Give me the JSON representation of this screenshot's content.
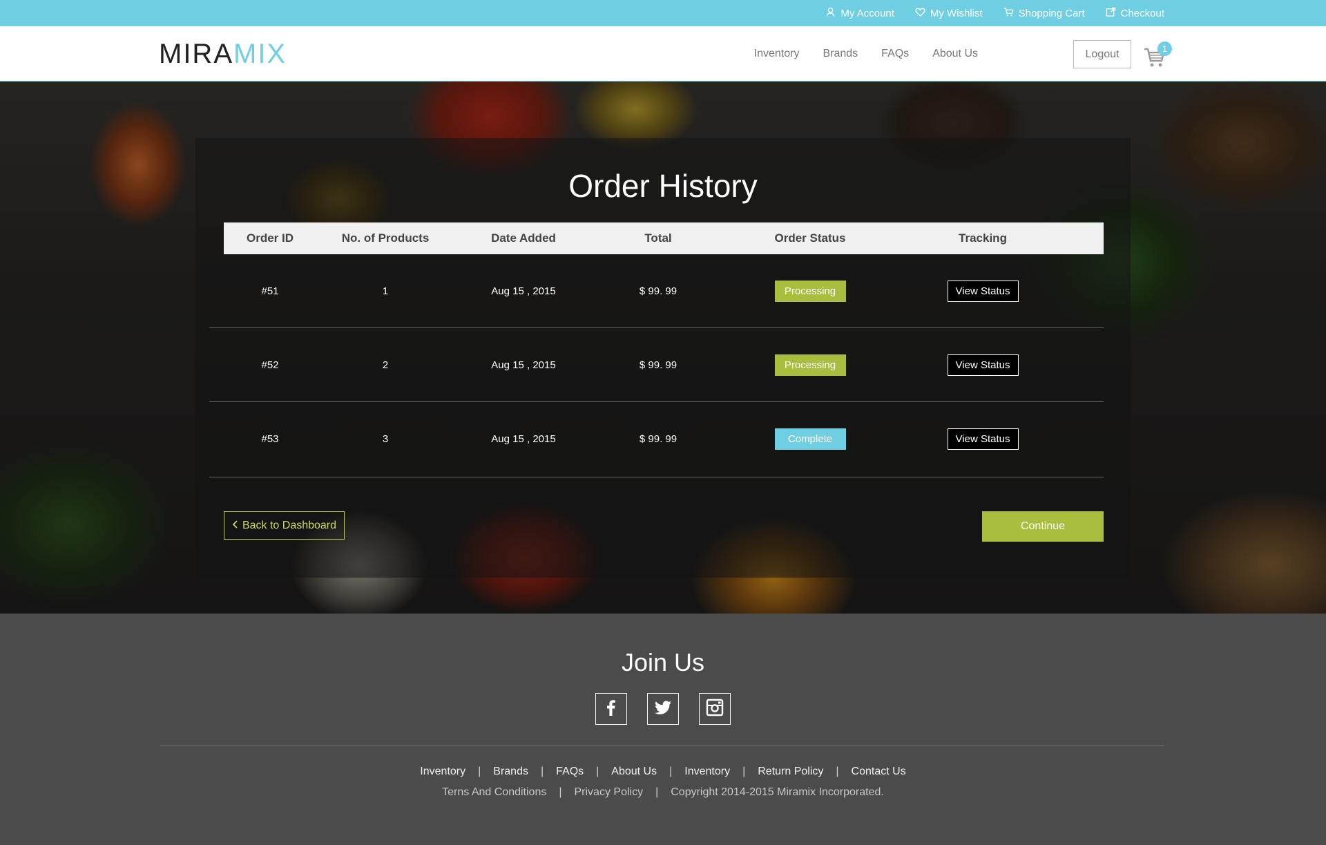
{
  "topbar": {
    "links": [
      {
        "label": "My Account",
        "icon": "user-icon"
      },
      {
        "label": "My Wishlist",
        "icon": "heart-icon"
      },
      {
        "label": "Shopping Cart",
        "icon": "cart-icon"
      },
      {
        "label": "Checkout",
        "icon": "checkout-icon"
      }
    ]
  },
  "header": {
    "logo_part1": "MIRA",
    "logo_part2": "MIX",
    "nav": [
      "Inventory",
      "Brands",
      "FAQs",
      "About Us"
    ],
    "logout_label": "Logout",
    "cart_count": "1"
  },
  "main": {
    "title": "Order History",
    "columns": [
      "Order ID",
      "No. of Products",
      "Date Added",
      "Total",
      "Order Status",
      "Tracking"
    ],
    "orders": [
      {
        "id": "#51",
        "products": "1",
        "date": "Aug 15 , 2015",
        "total": "$ 99. 99",
        "status": "Processing",
        "tracking": "View Status"
      },
      {
        "id": "#52",
        "products": "2",
        "date": "Aug 15 , 2015",
        "total": "$ 99. 99",
        "status": "Processing",
        "tracking": "View Status"
      },
      {
        "id": "#53",
        "products": "3",
        "date": "Aug 15 , 2015",
        "total": "$ 99. 99",
        "status": "Complete",
        "tracking": "View Status"
      }
    ],
    "back_label": "Back to Dashboard",
    "continue_label": "Continue"
  },
  "footer": {
    "join_title": "Join Us",
    "socials": [
      "facebook-icon",
      "twitter-icon",
      "instagram-icon"
    ],
    "links_row1": [
      "Inventory",
      "Brands",
      "FAQs",
      "About Us",
      "Inventory",
      "Return Policy",
      "Contact Us"
    ],
    "links_row2": [
      "Terns And Conditions",
      "Privacy Policy",
      "Copyright 2014-2015 Miramix Incorporated."
    ]
  },
  "colors": {
    "accent_blue": "#6ecfe2",
    "accent_green": "#a9bd3f",
    "footer_bg": "#4b4b4b"
  }
}
